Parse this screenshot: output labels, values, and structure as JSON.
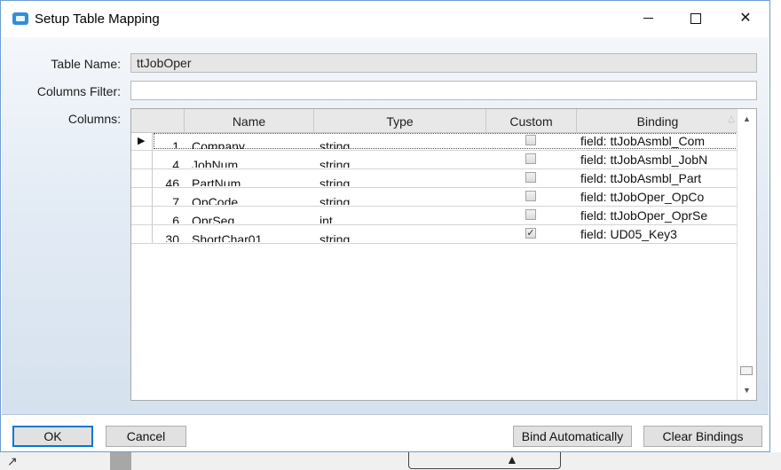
{
  "window": {
    "title": "Setup Table Mapping",
    "close_glyph": "✕"
  },
  "form": {
    "table_name_label": "Table Name:",
    "table_name_value": "ttJobOper",
    "columns_filter_label": "Columns Filter:",
    "columns_filter_value": "",
    "columns_label": "Columns:"
  },
  "grid": {
    "headers": {
      "name": "Name",
      "type": "Type",
      "custom": "Custom",
      "binding": "Binding"
    },
    "sort_glyph": "△",
    "current_row_glyph": "▶",
    "rows": [
      {
        "num": "1",
        "name": "Company",
        "type": "string",
        "custom": false,
        "binding": "field: ttJobAsmbl_Com"
      },
      {
        "num": "4",
        "name": "JobNum",
        "type": "string",
        "custom": false,
        "binding": "field: ttJobAsmbl_JobN"
      },
      {
        "num": "46",
        "name": "PartNum",
        "type": "string",
        "custom": false,
        "binding": "field: ttJobAsmbl_Part"
      },
      {
        "num": "7",
        "name": "OpCode",
        "type": "string",
        "custom": false,
        "binding": "field: ttJobOper_OpCo"
      },
      {
        "num": "6",
        "name": "OprSeq",
        "type": "int",
        "custom": false,
        "binding": "field: ttJobOper_OprSe"
      },
      {
        "num": "30",
        "name": "ShortChar01",
        "type": "string",
        "custom": true,
        "binding": "field: UD05_Key3"
      }
    ],
    "scroll_up_glyph": "▲",
    "scroll_down_glyph": "▼"
  },
  "buttons": {
    "ok": "OK",
    "cancel": "Cancel",
    "bind_automatically": "Bind Automatically",
    "clear_bindings": "Clear Bindings"
  },
  "icons": {
    "app": "app-window-icon",
    "minimize": "minimize-icon",
    "maximize": "maximize-icon",
    "close": "close-icon"
  },
  "colors": {
    "accent": "#0078d7",
    "window_border": "#6d9dd6"
  }
}
